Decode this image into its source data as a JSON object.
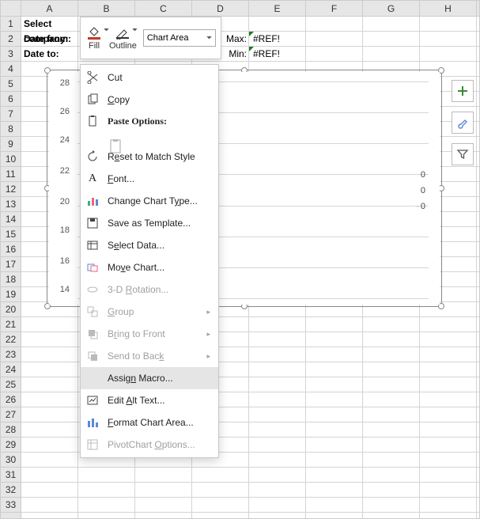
{
  "columns": [
    "A",
    "B",
    "C",
    "D",
    "E",
    "F",
    "G",
    "H"
  ],
  "rows_count": 33,
  "cells": {
    "a1": "Select company:",
    "a2": "Date from:",
    "a3": "Date to:",
    "d2": "Max:",
    "d3": "Min:",
    "e2": "#REF!",
    "e3": "#REF!"
  },
  "chart_data": {
    "type": "line",
    "y_ticks": [
      14,
      16,
      18,
      20,
      22,
      24,
      26,
      28
    ],
    "ylim": [
      14,
      28
    ],
    "series": [
      {
        "name": "0",
        "values": []
      },
      {
        "name": "0",
        "values": []
      },
      {
        "name": "0",
        "values": []
      }
    ],
    "legend_labels": [
      "0",
      "0",
      "0"
    ],
    "categories": [],
    "title": "",
    "xlabel": "",
    "ylabel": ""
  },
  "mini_toolbar": {
    "fill": "Fill",
    "outline": "Outline",
    "selector": "Chart Area"
  },
  "side_buttons": {
    "plus": "+",
    "brush": "Brush",
    "filter": "Filter"
  },
  "context_menu": {
    "cut": "Cut",
    "copy": "Copy",
    "paste_options": "Paste Options:",
    "reset": "Reset to Match Style",
    "font": "Font...",
    "change_type": "Change Chart Type...",
    "save_tmpl": "Save as Template...",
    "select_data": "Select Data...",
    "move_chart": "Move Chart...",
    "rotate3d": "3-D Rotation...",
    "group": "Group",
    "bring_front": "Bring to Front",
    "send_back": "Send to Back",
    "assign_macro": "Assign Macro...",
    "edit_alt": "Edit Alt Text...",
    "format_area": "Format Chart Area...",
    "pivot_opts": "PivotChart Options..."
  }
}
